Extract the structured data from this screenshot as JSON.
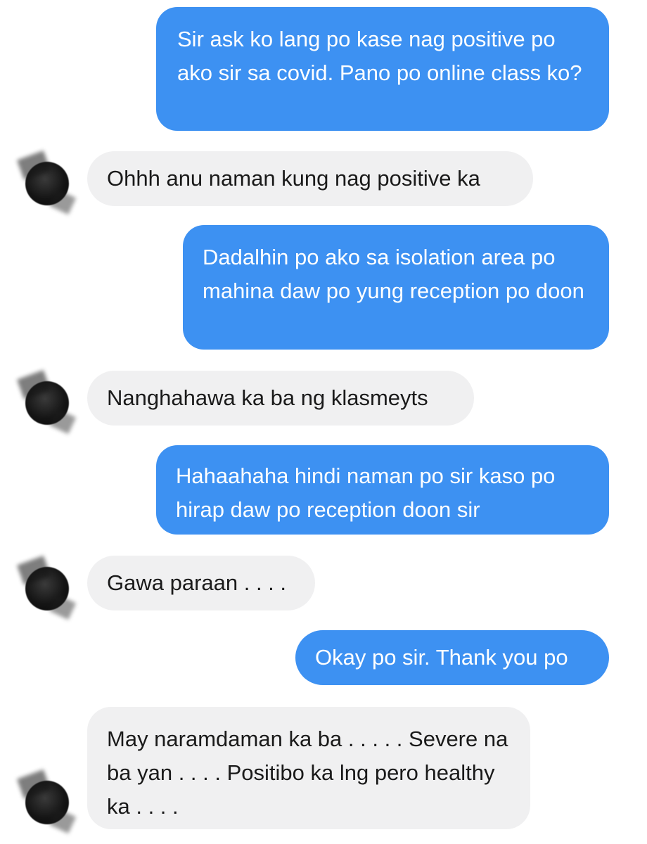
{
  "conversation": {
    "messages": [
      {
        "sender": "me",
        "text": "Sir ask ko lang po kase nag positive po ako sir sa covid. Pano po online class ko?"
      },
      {
        "sender": "other",
        "text": "Ohhh anu naman kung nag positive ka"
      },
      {
        "sender": "me",
        "text": "Dadalhin po ako sa isolation area po mahina daw po yung reception po doon"
      },
      {
        "sender": "other",
        "text": "Nanghahawa ka ba ng klasmeyts"
      },
      {
        "sender": "me",
        "text": "Hahaahaha hindi naman po sir kaso po hirap daw po reception doon sir"
      },
      {
        "sender": "other",
        "text": "Gawa paraan . . . ."
      },
      {
        "sender": "me",
        "text": "Okay po sir. Thank you po"
      },
      {
        "sender": "other",
        "text": "May naramdaman ka ba . . . . . Severe na ba yan . . . . Positibo ka lng pero healthy ka . . . ."
      }
    ]
  },
  "colors": {
    "sent_bubble": "#3d91f2",
    "received_bubble": "#f0f0f1",
    "sent_text": "#ffffff",
    "received_text": "#1a1a1a"
  },
  "icons": {
    "contact_avatar": "avatar-icon"
  }
}
